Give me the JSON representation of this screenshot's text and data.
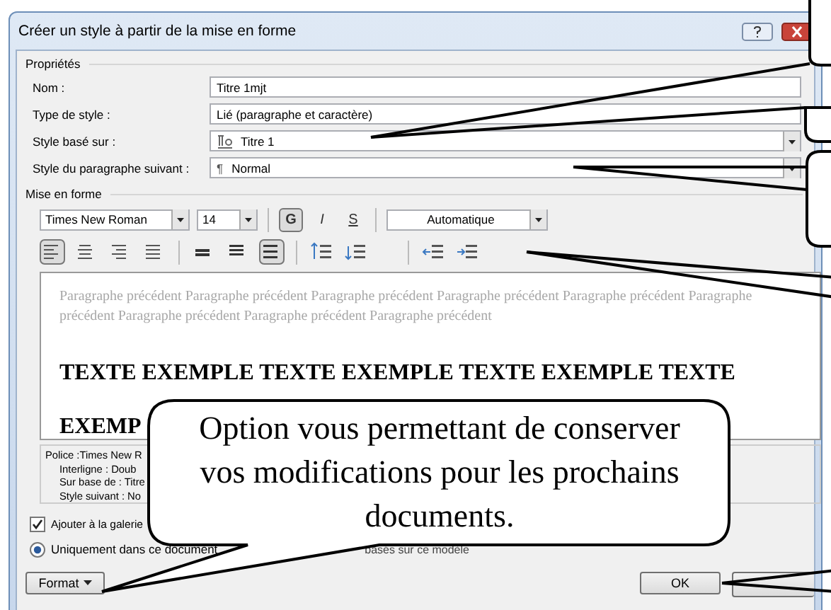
{
  "window": {
    "title": "Créer un style à partir de la mise en forme"
  },
  "properties": {
    "heading": "Propriétés",
    "rows": [
      {
        "label": "Nom :",
        "value": "Titre 1mjt",
        "kind": "text"
      },
      {
        "label": "Type de style :",
        "value": "Lié (paragraphe et caractère)",
        "kind": "text"
      },
      {
        "label": "Style basé sur :",
        "value": "Titre 1",
        "kind": "linked-style"
      },
      {
        "label": "Style du paragraphe suivant :",
        "value": "Normal",
        "kind": "paragraph-style",
        "marker": "¶"
      }
    ]
  },
  "formatting": {
    "heading": "Mise en forme",
    "font": "Times New Roman",
    "size": "14",
    "styles": [
      {
        "label": "G",
        "kind": "bold",
        "on": true
      },
      {
        "label": "I",
        "kind": "italic",
        "on": false
      },
      {
        "label": "S",
        "kind": "underline",
        "on": false
      }
    ],
    "font_color_choice": "Automatique",
    "alignments": [
      {
        "kind": "left",
        "selected": true
      },
      {
        "kind": "center",
        "selected": false
      },
      {
        "kind": "right",
        "selected": false
      },
      {
        "kind": "justify",
        "selected": false
      }
    ],
    "spacings": [
      {
        "kind": "single",
        "selected": false
      },
      {
        "kind": "one-half",
        "selected": false
      },
      {
        "kind": "double",
        "selected": true
      }
    ]
  },
  "preview": {
    "previous": "Paragraphe précédent Paragraphe précédent Paragraphe précédent Paragraphe précédent Paragraphe précédent Paragraphe précédent Paragraphe précédent Paragraphe précédent Paragraphe précédent",
    "sample": [
      "TEXTE EXEMPLE TEXTE EXEMPLE TEXTE EXEMPLE TEXTE",
      "EXEMP"
    ]
  },
  "description": [
    "Police :Times New R",
    "Interligne : Doub",
    "Sur base de : Titre",
    "Style suivant : No"
  ],
  "options": {
    "gallery": {
      "label": "Ajouter à la galerie",
      "checked": true
    },
    "scope": {
      "label": "Uniquement dans ce document",
      "selected": true
    },
    "scope_other_text": "basés sur ce modèle"
  },
  "buttons": {
    "format": "Format",
    "ok": "OK"
  },
  "callout": {
    "text": "Option vous permettant de conserver vos modifications pour les prochains documents."
  }
}
